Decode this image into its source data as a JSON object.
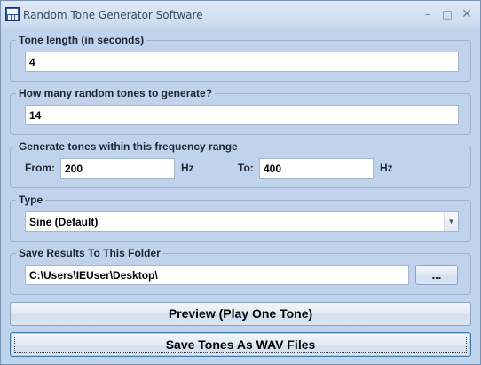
{
  "window": {
    "title": "Random Tone Generator Software",
    "controls": {
      "minimize": "–",
      "maximize": "□",
      "close": "✕"
    }
  },
  "tone_length": {
    "label": "Tone length (in seconds)",
    "value": "4"
  },
  "tone_count": {
    "label": "How many random tones to generate?",
    "value": "14"
  },
  "frequency": {
    "label": "Generate tones within this frequency range",
    "from_label": "From:",
    "from_value": "200",
    "from_unit": "Hz",
    "to_label": "To:",
    "to_value": "400",
    "to_unit": "Hz"
  },
  "type": {
    "label": "Type",
    "selected": "Sine (Default)"
  },
  "folder": {
    "label": "Save Results To This Folder",
    "path": "C:\\Users\\IEUser\\Desktop\\",
    "browse_label": "..."
  },
  "actions": {
    "preview_label": "Preview (Play One Tone)",
    "save_label": "Save Tones As WAV Files"
  },
  "colors": {
    "window_bg": "#bfd3ec",
    "group_border": "#9cb2cf"
  }
}
